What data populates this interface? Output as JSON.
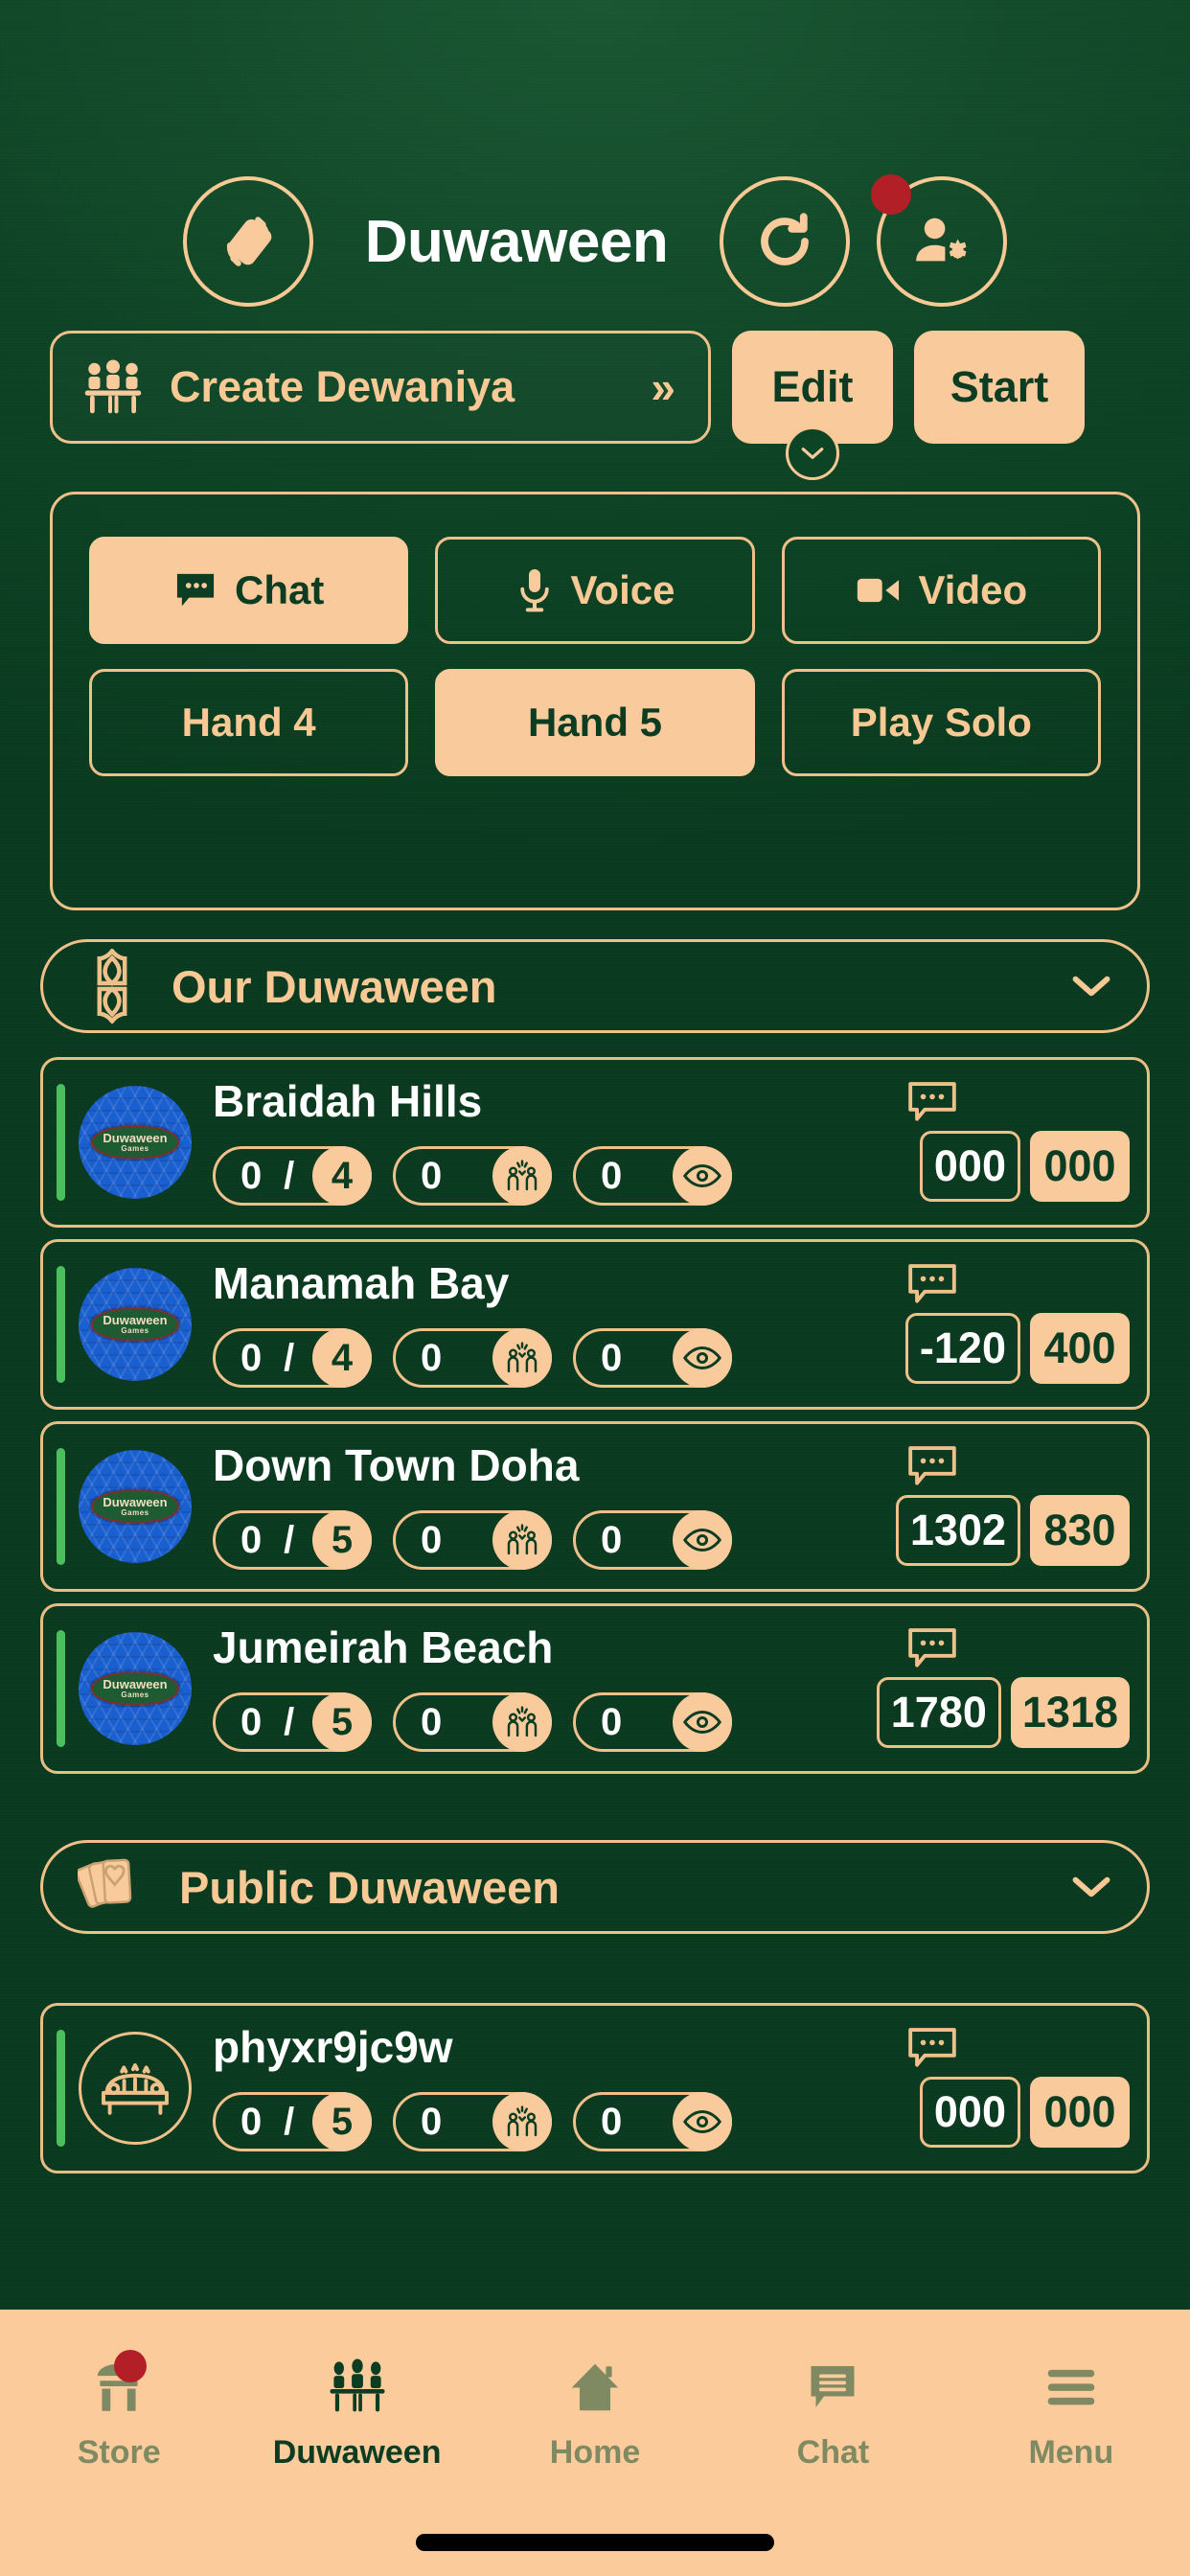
{
  "header": {
    "title": "Duwaween",
    "rotate_icon": "rotate-screen-icon",
    "refresh_icon": "refresh-icon",
    "profile_icon": "user-settings-icon",
    "profile_badge": true
  },
  "actions": {
    "create_label": "Create Dewaniya",
    "create_icon": "people-at-table-icon",
    "create_chevron": "»",
    "edit_label": "Edit",
    "start_label": "Start",
    "edit_caret": "⌄"
  },
  "modes": {
    "row1": [
      {
        "label": "Chat",
        "icon": "chat-bubble-icon",
        "active": true
      },
      {
        "label": "Voice",
        "icon": "microphone-icon",
        "active": false
      },
      {
        "label": "Video",
        "icon": "video-camera-icon",
        "active": false
      }
    ],
    "row2": [
      {
        "label": "Hand 4",
        "icon": "",
        "active": false
      },
      {
        "label": "Hand 5",
        "icon": "",
        "active": true
      },
      {
        "label": "Play Solo",
        "icon": "",
        "active": false
      }
    ]
  },
  "sections": [
    {
      "title": "Our Duwaween",
      "icon": "arabesque-ornament-icon",
      "chevron": "⌄",
      "rooms": [
        {
          "name": "Braidah Hills",
          "avatar": "card-back",
          "avatar_logo": "Duwaween",
          "avatar_logo_sub": "Games",
          "players": "0",
          "capacity": "4",
          "seated": "0",
          "seated_icon": "clapping-hands-icon",
          "watchers": "0",
          "watchers_icon": "eye-icon",
          "bubble_icon": "chat-bubble-dots-icon",
          "score_ours": "000",
          "score_theirs": "000"
        },
        {
          "name": "Manamah Bay",
          "avatar": "card-back",
          "avatar_logo": "Duwaween",
          "avatar_logo_sub": "Games",
          "players": "0",
          "capacity": "4",
          "seated": "0",
          "seated_icon": "clapping-hands-icon",
          "watchers": "0",
          "watchers_icon": "eye-icon",
          "bubble_icon": "chat-bubble-dots-icon",
          "score_ours": "-120",
          "score_theirs": "400"
        },
        {
          "name": "Down Town Doha",
          "avatar": "card-back",
          "avatar_logo": "Duwaween",
          "avatar_logo_sub": "Games",
          "players": "0",
          "capacity": "5",
          "seated": "0",
          "seated_icon": "clapping-hands-icon",
          "watchers": "0",
          "watchers_icon": "eye-icon",
          "bubble_icon": "chat-bubble-dots-icon",
          "score_ours": "1302",
          "score_theirs": "830"
        },
        {
          "name": "Jumeirah Beach",
          "avatar": "card-back",
          "avatar_logo": "Duwaween",
          "avatar_logo_sub": "Games",
          "players": "0",
          "capacity": "5",
          "seated": "0",
          "seated_icon": "clapping-hands-icon",
          "watchers": "0",
          "watchers_icon": "eye-icon",
          "bubble_icon": "chat-bubble-dots-icon",
          "score_ours": "1780",
          "score_theirs": "1318"
        }
      ]
    },
    {
      "title": "Public Duwaween",
      "icon": "playing-cards-icon",
      "chevron": "⌄",
      "rooms": [
        {
          "name": "phyxr9jc9w",
          "avatar": "majlis-sofa",
          "avatar_logo": "",
          "avatar_logo_sub": "",
          "players": "0",
          "capacity": "5",
          "seated": "0",
          "seated_icon": "clapping-hands-icon",
          "watchers": "0",
          "watchers_icon": "eye-icon",
          "bubble_icon": "chat-bubble-dots-icon",
          "score_ours": "000",
          "score_theirs": "000"
        }
      ]
    }
  ],
  "bottom_nav": [
    {
      "label": "Store",
      "icon": "store-tent-icon",
      "active": false,
      "badge": true
    },
    {
      "label": "Duwaween",
      "icon": "people-at-table-icon",
      "active": true,
      "badge": false
    },
    {
      "label": "Home",
      "icon": "house-icon",
      "active": false,
      "badge": false
    },
    {
      "label": "Chat",
      "icon": "chat-lines-icon",
      "active": false,
      "badge": false
    },
    {
      "label": "Menu",
      "icon": "hamburger-menu-icon",
      "active": false,
      "badge": false
    }
  ],
  "colors": {
    "felt_green": "#0d4425",
    "peach": "#f9cb9c",
    "gold_border": "#f0c08a",
    "white": "#ffffff",
    "dark_green_text": "#0c3d22",
    "badge_red": "#b31f26",
    "stripe_green": "#4bbf5c",
    "card_blue": "#1a5fd0"
  }
}
